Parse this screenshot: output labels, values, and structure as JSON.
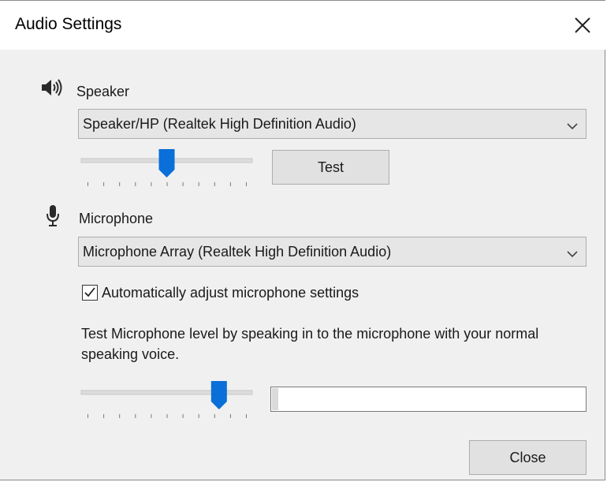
{
  "window": {
    "title": "Audio Settings"
  },
  "speaker": {
    "label": "Speaker",
    "device": "Speaker/HP (Realtek High Definition Audio)",
    "volume_level": 0.5,
    "test_label": "Test"
  },
  "microphone": {
    "label": "Microphone",
    "device": "Microphone Array (Realtek High Definition Audio)",
    "auto_adjust_label": "Automatically adjust microphone settings",
    "auto_adjust_checked": true,
    "instructions": "Test Microphone level by speaking in to the microphone with your normal speaking voice.",
    "volume_level": 0.83,
    "input_level": 0.02
  },
  "footer": {
    "close_label": "Close"
  },
  "colors": {
    "thumb": "#0a6fd8",
    "track": "#dcdcdc"
  }
}
